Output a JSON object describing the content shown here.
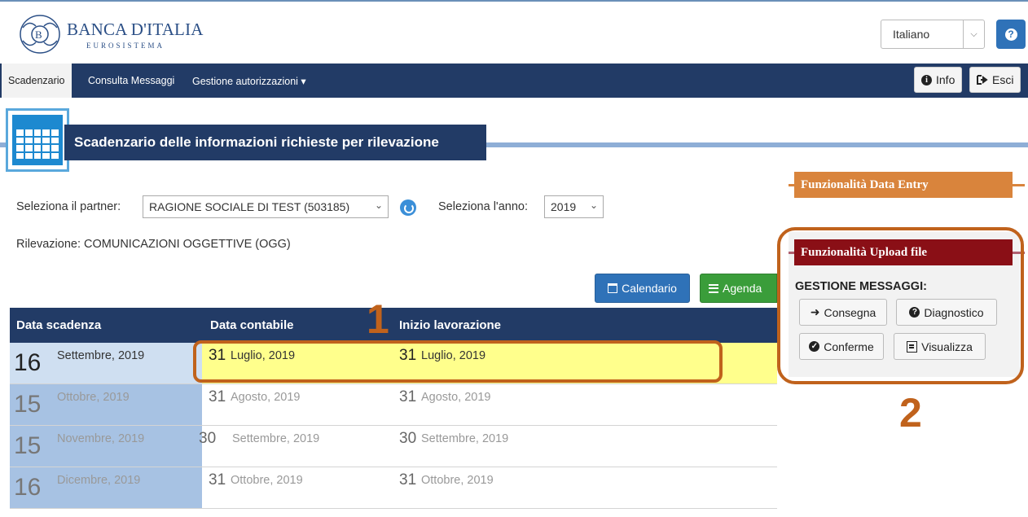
{
  "header": {
    "logo_title": "BANCA D'ITALIA",
    "logo_subtitle": "EUROSISTEMA",
    "language": "Italiano",
    "help_label": "?"
  },
  "nav": {
    "items": [
      "Scadenzario",
      "Consulta Messaggi",
      "Gestione autorizzazioni ▾"
    ],
    "info_label": "Info",
    "exit_label": "Esci"
  },
  "page_title": "Scadenzario delle informazioni richieste per rilevazione",
  "filters": {
    "partner_label": "Seleziona il partner:",
    "partner_value": "RAGIONE SOCIALE DI TEST (503185)",
    "year_label": "Seleziona l'anno:",
    "year_value": "2019",
    "rilevazione": "Rilevazione: COMUNICAZIONI OGGETTIVE (OGG)"
  },
  "view_buttons": {
    "calendario": "Calendario",
    "agenda": "Agenda"
  },
  "table": {
    "headers": [
      "Data scadenza",
      "Data contabile",
      "Inizio lavorazione"
    ],
    "rows": [
      {
        "due_day": "16",
        "due_rest": "Settembre, 2019",
        "acc_day": "31",
        "acc_rest": "Luglio, 2019",
        "start_day": "31",
        "start_rest": "Luglio, 2019"
      },
      {
        "due_day": "15",
        "due_rest": "Ottobre, 2019",
        "acc_day": "31",
        "acc_rest": "Agosto, 2019",
        "start_day": "31",
        "start_rest": "Agosto, 2019"
      },
      {
        "due_day": "15",
        "due_rest": "Novembre, 2019",
        "acc_day": "30",
        "acc_rest": "Settembre, 2019",
        "start_day": "30",
        "start_rest": "Settembre, 2019"
      },
      {
        "due_day": "16",
        "due_rest": "Dicembre, 2019",
        "acc_day": "31",
        "acc_rest": "Ottobre, 2019",
        "start_day": "31",
        "start_rest": "Ottobre, 2019"
      }
    ]
  },
  "side": {
    "data_entry_title": "Funzionalità Data Entry",
    "upload_title": "Funzionalità Upload file",
    "gestione_label": "GESTIONE MESSAGGI:",
    "buttons": [
      "Consegna",
      "Diagnostico",
      "Conferme",
      "Visualizza"
    ]
  },
  "annotations": [
    "1",
    "2"
  ],
  "colors": {
    "navy": "#223b66",
    "highlight": "#ffff8c",
    "annotation": "#c0621c",
    "data_entry": "#d9843c",
    "upload": "#8a0f16"
  }
}
